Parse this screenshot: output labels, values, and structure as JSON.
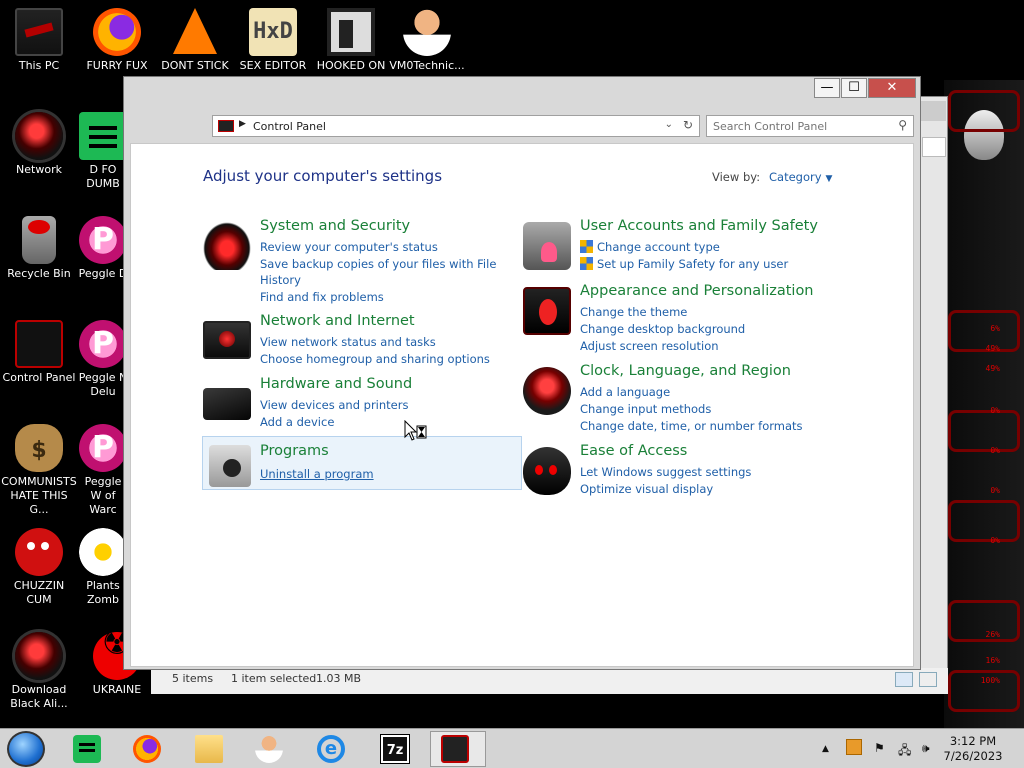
{
  "desktop": {
    "icons": [
      {
        "label": "This PC",
        "icon": "computer-icon"
      },
      {
        "label": "FURRY FUX",
        "icon": "firefox-icon"
      },
      {
        "label": "DONT STICK",
        "icon": "vlc-icon"
      },
      {
        "label": "SEX EDITOR",
        "icon": "hxd-icon"
      },
      {
        "label": "HOOKED ON",
        "icon": "hooked-on-icon"
      },
      {
        "label": "VM0Technic...",
        "icon": "doctor-icon"
      },
      {
        "label": "Network",
        "icon": "network-icon"
      },
      {
        "label": "D FO DUMB",
        "icon": "spreadsheet-icon"
      },
      {
        "label": "Recycle Bin",
        "icon": "recycle-bin-icon"
      },
      {
        "label": "Peggle D",
        "icon": "peggle-icon"
      },
      {
        "label": "Control Panel",
        "icon": "control-panel-icon"
      },
      {
        "label": "Peggle N Delu",
        "icon": "peggle-icon"
      },
      {
        "label": "COMMUNISTS HATE THIS G...",
        "icon": "money-bag-icon"
      },
      {
        "label": "Peggle W of Warc",
        "icon": "peggle-icon"
      },
      {
        "label": "CHUZZIN CUM",
        "icon": "chuzzle-icon"
      },
      {
        "label": "Plants Zomb",
        "icon": "plants-icon"
      },
      {
        "label": "Download Black Ali...",
        "icon": "download-icon"
      },
      {
        "label": "UKRAINE",
        "icon": "radiation-icon"
      }
    ]
  },
  "window": {
    "title": "Control Panel",
    "min_label": "—",
    "max_label": "☐",
    "close_label": "✕",
    "address_path": "Control Panel",
    "search_placeholder": "Search Control Panel",
    "heading": "Adjust your computer's settings",
    "view_by_label": "View by:",
    "view_by_value": "Category",
    "categories_left": [
      {
        "title": "System and Security",
        "links": [
          "Review your computer's status",
          "Save backup copies of your files with File History",
          "Find and fix problems"
        ]
      },
      {
        "title": "Network and Internet",
        "links": [
          "View network status and tasks",
          "Choose homegroup and sharing options"
        ]
      },
      {
        "title": "Hardware and Sound",
        "links": [
          "View devices and printers",
          "Add a device"
        ]
      },
      {
        "title": "Programs",
        "links": [
          "Uninstall a program"
        ]
      }
    ],
    "categories_right": [
      {
        "title": "User Accounts and Family Safety",
        "links": [
          "Change account type",
          "Set up Family Safety for any user"
        ]
      },
      {
        "title": "Appearance and Personalization",
        "links": [
          "Change the theme",
          "Change desktop background",
          "Adjust screen resolution"
        ]
      },
      {
        "title": "Clock, Language, and Region",
        "links": [
          "Add a language",
          "Change input methods",
          "Change date, time, or number formats"
        ]
      },
      {
        "title": "Ease of Access",
        "links": [
          "Let Windows suggest settings",
          "Optimize visual display"
        ]
      }
    ]
  },
  "background_window": {
    "status_items": "5 items",
    "status_selected": "1 item selected",
    "status_size": "1.03 MB"
  },
  "gadget": {
    "percentages": [
      "6%",
      "49%",
      "49%",
      "0%",
      "0%",
      "0%",
      "0%",
      "26%",
      "16%",
      "100%"
    ]
  },
  "taskbar": {
    "time": "3:12 PM",
    "date": "7/26/2023",
    "items": [
      "spreadsheet-icon",
      "firefox-icon",
      "file-explorer-icon",
      "doctor-icon",
      "internet-explorer-icon",
      "7zip-icon",
      "control-panel-icon"
    ]
  }
}
